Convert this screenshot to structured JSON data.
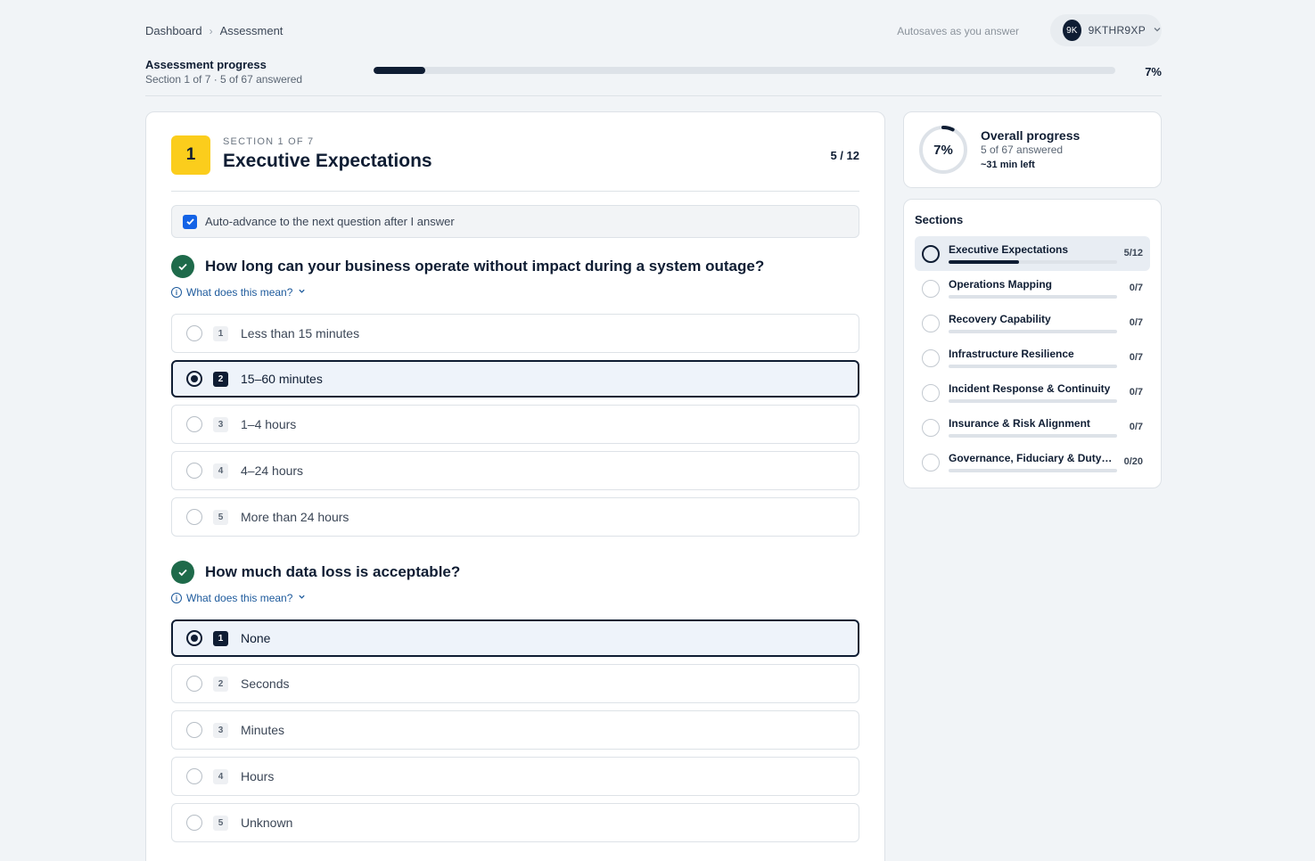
{
  "breadcrumb": {
    "items": [
      "Dashboard",
      "Assessment"
    ],
    "separator": "›"
  },
  "autosave_text": "Autosaves as you answer",
  "user": {
    "initials": "9K",
    "id": "9KTHR9XP"
  },
  "assessment_progress": {
    "title": "Assessment progress",
    "subtitle": "Section 1 of 7 · 5 of 67 answered",
    "percent_label": "7%",
    "fraction": 0.07
  },
  "section": {
    "number": "1",
    "kicker": "SECTION 1 OF 7",
    "title": "Executive Expectations",
    "count": "5 / 12"
  },
  "auto_advance": {
    "label": "Auto-advance to the next question after I answer",
    "checked": true
  },
  "help_label": "What does this mean?",
  "questions": [
    {
      "text": "How long can your business operate without impact during a system outage?",
      "options": [
        {
          "key": "1",
          "label": "Less than 15 minutes",
          "selected": false
        },
        {
          "key": "2",
          "label": "15–60 minutes",
          "selected": true
        },
        {
          "key": "3",
          "label": "1–4 hours",
          "selected": false
        },
        {
          "key": "4",
          "label": "4–24 hours",
          "selected": false
        },
        {
          "key": "5",
          "label": "More than 24 hours",
          "selected": false
        }
      ]
    },
    {
      "text": "How much data loss is acceptable?",
      "options": [
        {
          "key": "1",
          "label": "None",
          "selected": true
        },
        {
          "key": "2",
          "label": "Seconds",
          "selected": false
        },
        {
          "key": "3",
          "label": "Minutes",
          "selected": false
        },
        {
          "key": "4",
          "label": "Hours",
          "selected": false
        },
        {
          "key": "5",
          "label": "Unknown",
          "selected": false
        }
      ]
    }
  ],
  "overall": {
    "percent_label": "7%",
    "fraction": 0.07,
    "title": "Overall progress",
    "subtitle": "5 of 67 answered",
    "eta": "~31 min left"
  },
  "sections_panel": {
    "title": "Sections",
    "items": [
      {
        "name": "Executive Expectations",
        "count": "5/12",
        "fraction": 0.42,
        "active": true
      },
      {
        "name": "Operations Mapping",
        "count": "0/7",
        "fraction": 0,
        "active": false
      },
      {
        "name": "Recovery Capability",
        "count": "0/7",
        "fraction": 0,
        "active": false
      },
      {
        "name": "Infrastructure Resilience",
        "count": "0/7",
        "fraction": 0,
        "active": false
      },
      {
        "name": "Incident Response & Continuity",
        "count": "0/7",
        "fraction": 0,
        "active": false
      },
      {
        "name": "Insurance & Risk Alignment",
        "count": "0/7",
        "fraction": 0,
        "active": false
      },
      {
        "name": "Governance, Fiduciary & Duty Compliance",
        "count": "0/20",
        "fraction": 0,
        "active": false
      }
    ]
  },
  "colors": {
    "navy": "#0f1d33",
    "accent_yellow": "#fbcd1c",
    "check_green": "#1e6a4a",
    "link_blue": "#1d5a9c",
    "checkbox_blue": "#1463e6"
  }
}
